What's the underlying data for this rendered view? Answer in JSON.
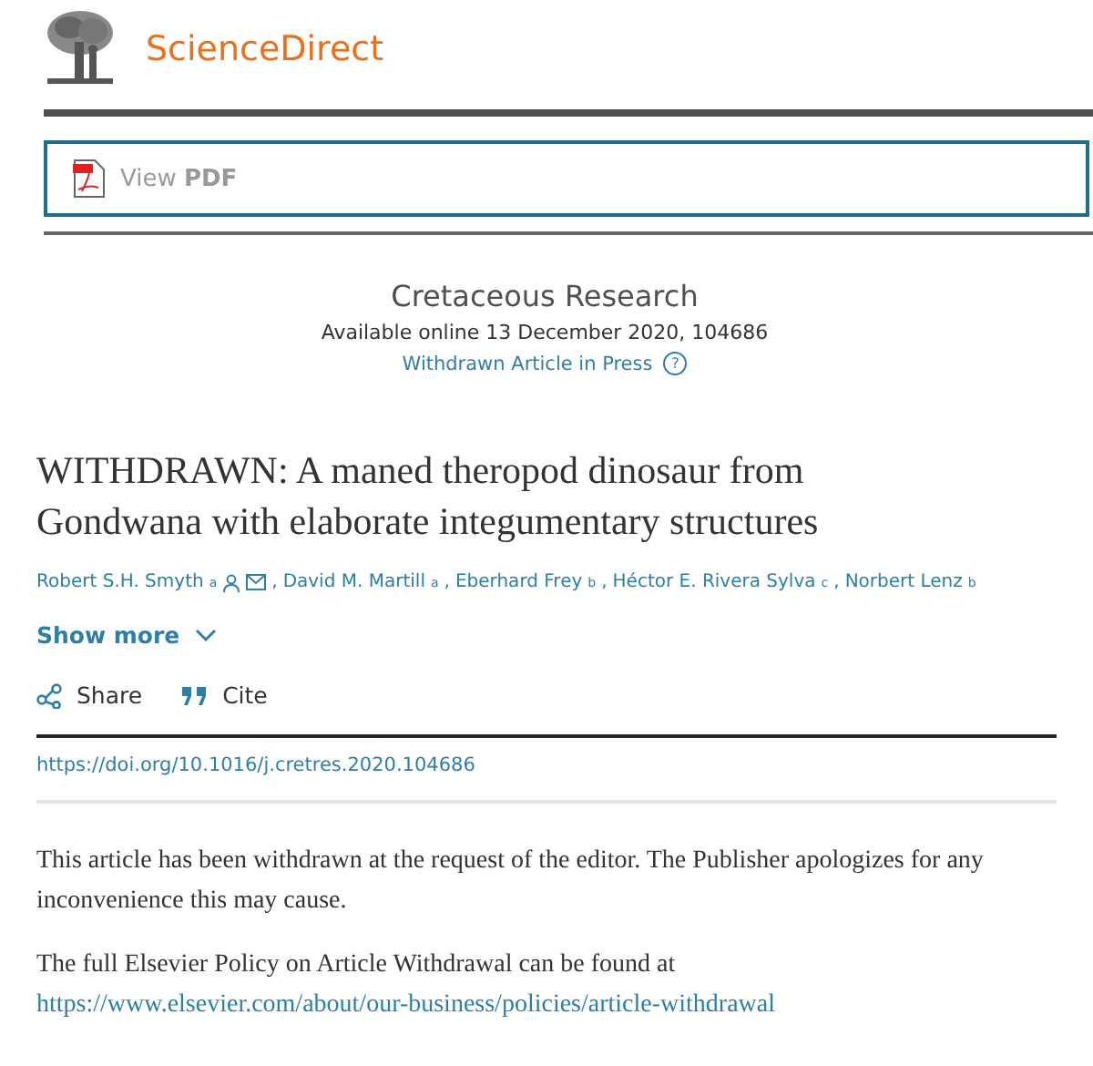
{
  "header": {
    "brand": "ScienceDirect"
  },
  "pdf_button": {
    "label_prefix": "View",
    "label_bold": "PDF"
  },
  "journal": {
    "name": "Cretaceous Research",
    "availability": "Available online 13 December 2020, 104686",
    "status_link": "Withdrawn Article in Press",
    "help_icon": "?"
  },
  "article": {
    "title": "WITHDRAWN: A maned theropod dinosaur from Gondwana with elaborate integumentary structures",
    "authors": [
      {
        "name": "Robert S.H. Smyth",
        "affiliation": "a",
        "contact": true,
        "separator": ","
      },
      {
        "name": "David M. Martill",
        "affiliation": "a",
        "contact": false,
        "separator": ","
      },
      {
        "name": "Eberhard Frey",
        "affiliation": "b",
        "contact": false,
        "separator": ","
      },
      {
        "name": "Héctor E. Rivera Sylva",
        "affiliation": "c",
        "contact": false,
        "separator": ","
      },
      {
        "name": "Norbert Lenz",
        "affiliation": "b",
        "contact": false
      }
    ],
    "show_more": "Show more",
    "actions": [
      {
        "kind": "share",
        "label": "Share"
      },
      {
        "kind": "cite",
        "label": "Cite"
      }
    ],
    "doi": "https://doi.org/10.1016/j.cretres.2020.104686"
  },
  "notice": {
    "paragraph_1": "This article has been withdrawn at the request of the editor. The Publisher apologizes for any inconvenience this may cause.",
    "paragraph_2": "The full Elsevier Policy on Article Withdrawal can be found at",
    "policy_link": "https://www.elsevier.com/about/our-business/policies/article-withdrawal"
  }
}
